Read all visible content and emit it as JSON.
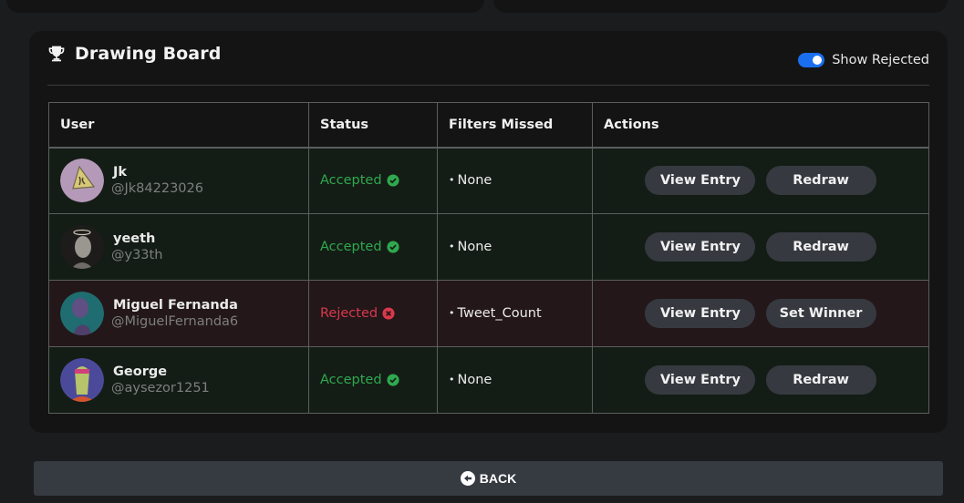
{
  "board": {
    "title": "Drawing Board",
    "title_icon": "trophy-icon",
    "toggle": {
      "label": "Show Rejected",
      "checked": true,
      "color": "#1a6ff0"
    }
  },
  "table": {
    "columns": [
      "User",
      "Status",
      "Filters Missed",
      "Actions"
    ],
    "rows": [
      {
        "name": "Jk",
        "handle": "@Jk84223026",
        "status": "Accepted",
        "status_icon": "check-circle-icon",
        "filters_missed": "None",
        "actions": [
          "View Entry",
          "Redraw"
        ]
      },
      {
        "name": "yeeth",
        "handle": "@y33th",
        "status": "Accepted",
        "status_icon": "check-circle-icon",
        "filters_missed": "None",
        "actions": [
          "View Entry",
          "Redraw"
        ]
      },
      {
        "name": "Miguel Fernanda",
        "handle": "@MiguelFernanda6",
        "status": "Rejected",
        "status_icon": "x-circle-icon",
        "filters_missed": "Tweet_Count",
        "actions": [
          "View Entry",
          "Set Winner"
        ]
      },
      {
        "name": "George",
        "handle": "@aysezor1251",
        "status": "Accepted",
        "status_icon": "check-circle-icon",
        "filters_missed": "None",
        "actions": [
          "View Entry",
          "Redraw"
        ]
      }
    ]
  },
  "colors": {
    "accepted": "#2fa84f",
    "rejected": "#d9394b",
    "accepted_row": "#141d15",
    "rejected_row": "#231719"
  },
  "footer": {
    "back_label": "BACK",
    "back_icon": "arrow-left-circle-icon"
  }
}
